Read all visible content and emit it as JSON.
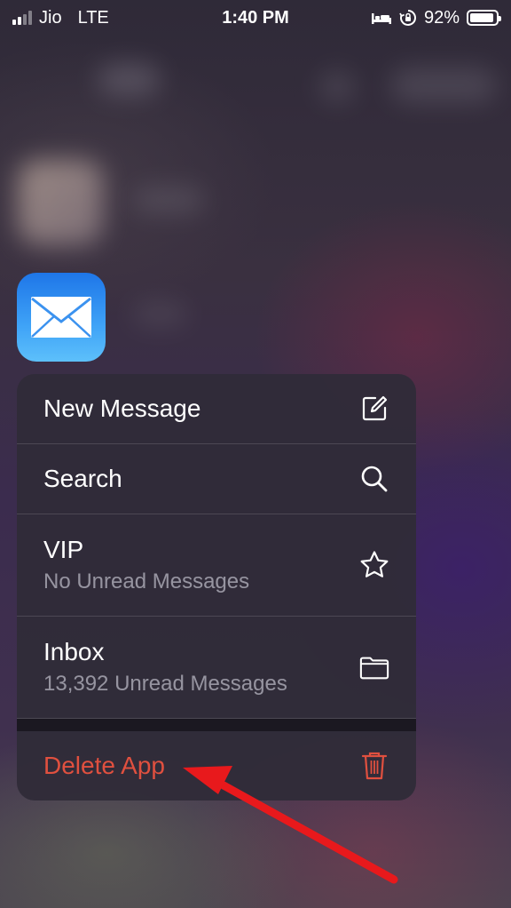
{
  "status_bar": {
    "carrier": "Jio",
    "network": "LTE",
    "time": "1:40 PM",
    "battery_percent": "92%",
    "battery_level": 0.92
  },
  "app": {
    "name_icon": "mail-icon",
    "accent": "#2b8ef2"
  },
  "menu": {
    "items": [
      {
        "label": "New Message",
        "icon": "compose-icon"
      },
      {
        "label": "Search",
        "icon": "search-icon"
      },
      {
        "label": "VIP",
        "subtitle": "No Unread Messages",
        "icon": "star-icon"
      },
      {
        "label": "Inbox",
        "subtitle": "13,392 Unread Messages",
        "icon": "folder-icon"
      }
    ],
    "destructive": {
      "label": "Delete App",
      "icon": "trash-icon",
      "color": "#e0503f"
    }
  },
  "annotation": {
    "type": "arrow",
    "color": "#e8191c"
  }
}
